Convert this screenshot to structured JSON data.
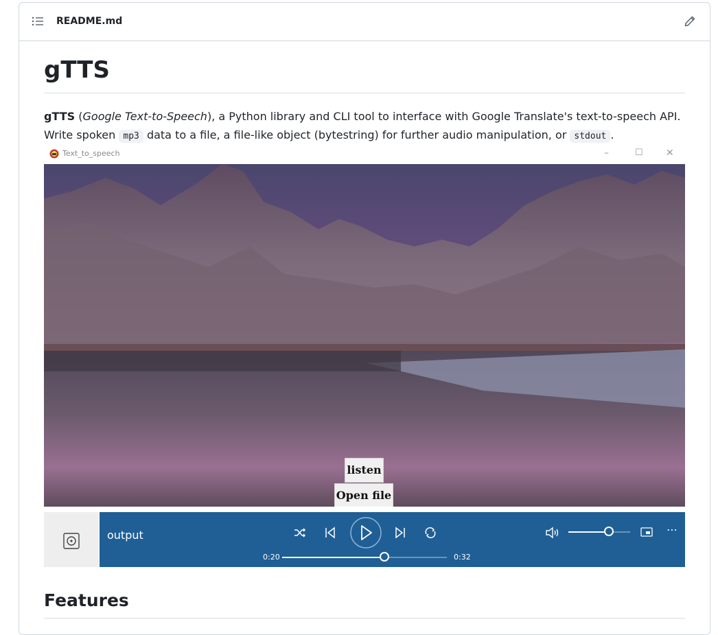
{
  "file_header": {
    "filename": "README.md"
  },
  "readme": {
    "title": "gTTS",
    "intro": {
      "strong": "gTTS",
      "open_paren": " (",
      "em": "Google Text-to-Speech",
      "rest1": "), a Python library and CLI tool to interface with Google Translate's text-to-speech API. Write spoken ",
      "code1": "mp3",
      "rest2": " data to a file, a file-like object (bytestring) for further audio manipulation, or ",
      "code2": "stdout",
      "end": "."
    },
    "features_heading": "Features"
  },
  "app_window": {
    "title": "Text_to_speech",
    "buttons": {
      "listen": "listen",
      "open_file": "Open file"
    }
  },
  "media_player": {
    "track_name": "output",
    "elapsed": "0:20",
    "total": "0:32",
    "progress": 0.62,
    "volume": 0.65
  },
  "icons": [
    "list-icon",
    "pencil-icon",
    "app-icon",
    "disc-icon",
    "shuffle-icon",
    "previous-icon",
    "play-icon",
    "next-icon",
    "repeat-icon",
    "volume-icon",
    "mini-view-icon",
    "more-icon"
  ]
}
